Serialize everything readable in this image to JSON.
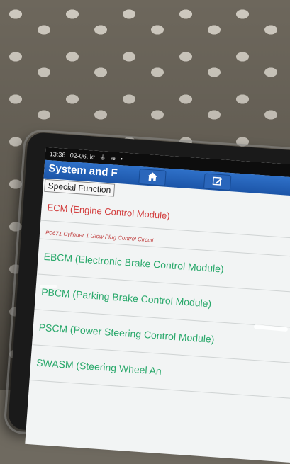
{
  "status_bar": {
    "time": "13:36",
    "date": "02-06, kt",
    "icons": [
      "usb-icon",
      "wifi-icon",
      "signal-icon"
    ]
  },
  "header": {
    "title": "System and F",
    "home_icon": "home-icon",
    "edit_icon": "edit-icon"
  },
  "breadcrumb": {
    "label": "Special Function"
  },
  "list": {
    "items": [
      {
        "label": "ECM (Engine Control Module)"
      },
      {
        "label": "P0671 Cylinder 1 Glow Plug Control Circuit"
      },
      {
        "label": "EBCM (Electronic Brake Control Module)"
      },
      {
        "label": "PBCM (Parking Brake Control Module)"
      },
      {
        "label": "PSCM (Power Steering Control Module)"
      },
      {
        "label": "SWASM (Steering Wheel An"
      }
    ]
  },
  "colors": {
    "header_blue": "#1c55a8",
    "ecm_red": "#d23c3c",
    "module_green": "#28a86a"
  }
}
